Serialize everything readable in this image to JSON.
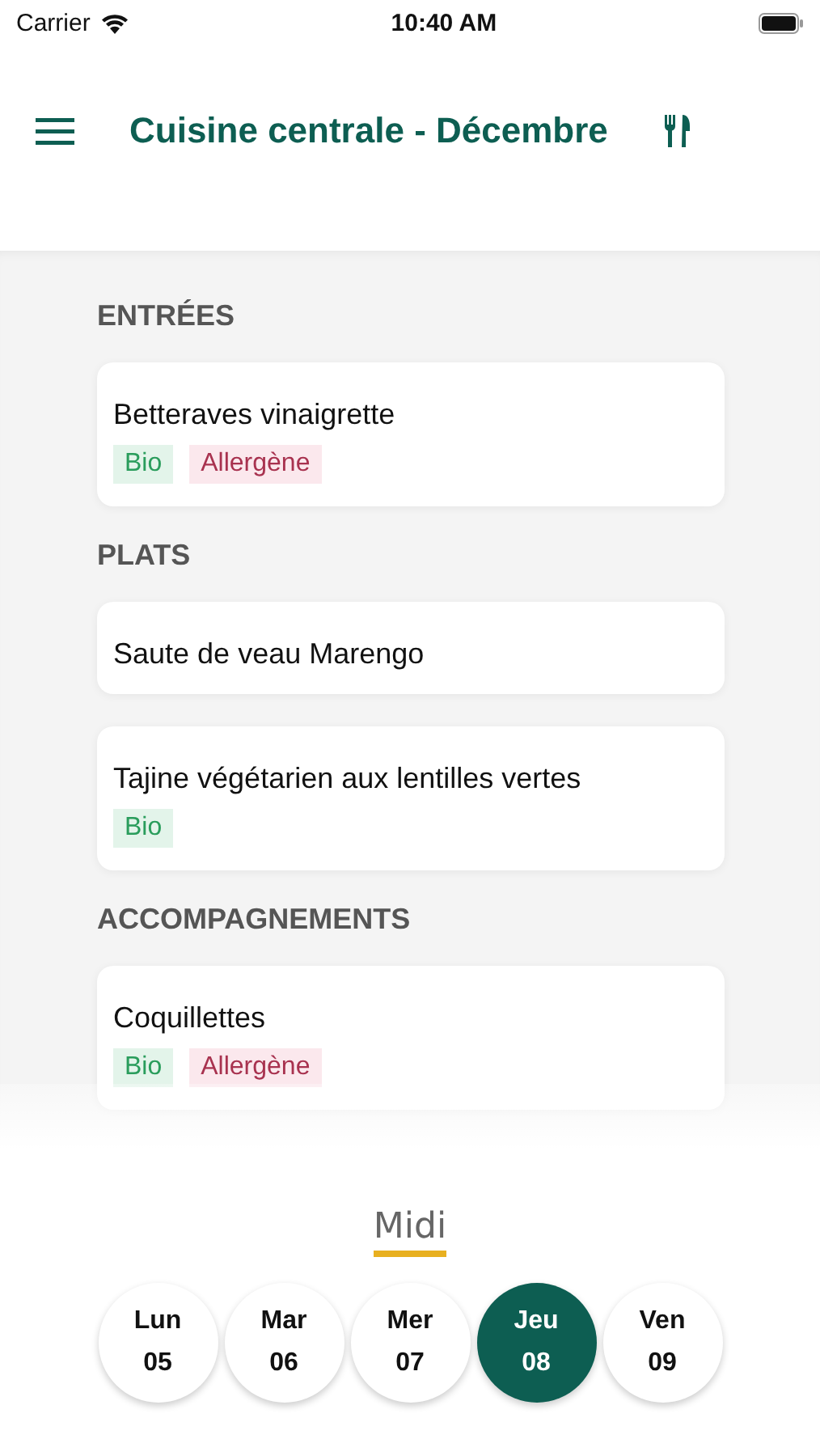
{
  "status_bar": {
    "carrier": "Carrier",
    "time": "10:40 AM"
  },
  "header": {
    "title": "Cuisine centrale - Décembre"
  },
  "sections": [
    {
      "title": "ENTRÉES",
      "dishes": [
        {
          "name": "Betteraves vinaigrette",
          "tags": [
            {
              "kind": "bio",
              "label": "Bio"
            },
            {
              "kind": "allergen",
              "label": "Allergène"
            }
          ]
        }
      ]
    },
    {
      "title": "PLATS",
      "dishes": [
        {
          "name": "Saute de veau Marengo"
        },
        {
          "name": "Tajine végétarien aux lentilles vertes",
          "tags": [
            {
              "kind": "bio",
              "label": "Bio"
            }
          ]
        }
      ]
    },
    {
      "title": "ACCOMPAGNEMENTS",
      "dishes": [
        {
          "name": "Coquillettes",
          "tags": [
            {
              "kind": "bio",
              "label": "Bio"
            },
            {
              "kind": "allergen",
              "label": "Allergène"
            }
          ]
        }
      ]
    }
  ],
  "meal_tab": {
    "label": "Midi",
    "selected": true
  },
  "days": [
    {
      "day": "Lun",
      "date": "05",
      "selected": false
    },
    {
      "day": "Mar",
      "date": "06",
      "selected": false
    },
    {
      "day": "Mer",
      "date": "07",
      "selected": false
    },
    {
      "day": "Jeu",
      "date": "08",
      "selected": true
    },
    {
      "day": "Ven",
      "date": "09",
      "selected": false
    }
  ]
}
